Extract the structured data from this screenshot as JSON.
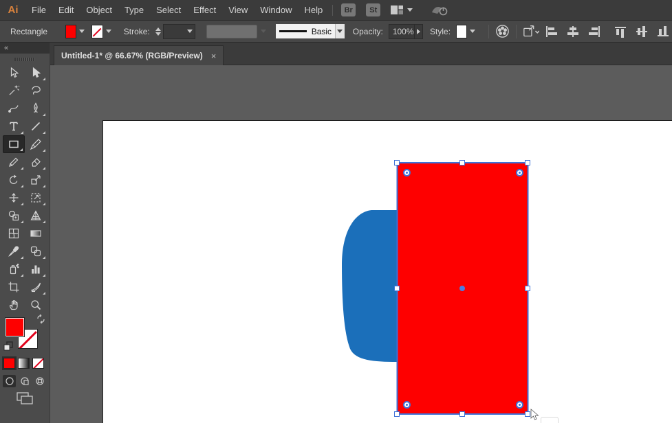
{
  "app": {
    "logo": "Ai",
    "name": "Adobe Illustrator"
  },
  "menu": {
    "items": [
      "File",
      "Edit",
      "Object",
      "Type",
      "Select",
      "Effect",
      "View",
      "Window",
      "Help"
    ]
  },
  "quick_buttons": {
    "bridge_label": "Br",
    "stock_label": "St"
  },
  "control_bar": {
    "context_label": "Rectangle",
    "fill_color": "#FE0000",
    "stroke_color": "none",
    "stroke_label": "Stroke:",
    "stroke_style_value": "Basic",
    "opacity_label": "Opacity:",
    "opacity_value": "100%",
    "style_label": "Style:"
  },
  "tab_bar": {
    "document_title": "Untitled-1* @ 66.67% (RGB/Preview)"
  },
  "icons": {
    "collapse": "«",
    "close": "×"
  },
  "toolbar": {
    "selected_tool": "rectangle",
    "tools": [
      "selection",
      "direct-selection",
      "magic-wand",
      "lasso",
      "curvature",
      "pen",
      "type",
      "line-segment",
      "rectangle",
      "paintbrush",
      "pencil",
      "eraser",
      "rotate",
      "scale",
      "width",
      "free-transform",
      "shape-builder",
      "perspective-grid",
      "mesh",
      "gradient",
      "eyedropper",
      "blend",
      "symbol-sprayer",
      "column-graph",
      "artboard",
      "slice",
      "hand",
      "zoom"
    ],
    "fill_color": "#FE0000",
    "stroke_color": "none"
  },
  "canvas": {
    "zoom_percent": "66.67%",
    "color_mode": "RGB/Preview",
    "background": "#5C5C5C",
    "artboard_color": "#FFFFFF",
    "selection_color": "#3E72D8",
    "shapes": [
      {
        "name": "blue-blob",
        "type": "blob",
        "fill": "#1B6FBA"
      },
      {
        "name": "red-rectangle",
        "type": "rectangle",
        "fill": "#FE0000",
        "selected": true
      }
    ]
  }
}
